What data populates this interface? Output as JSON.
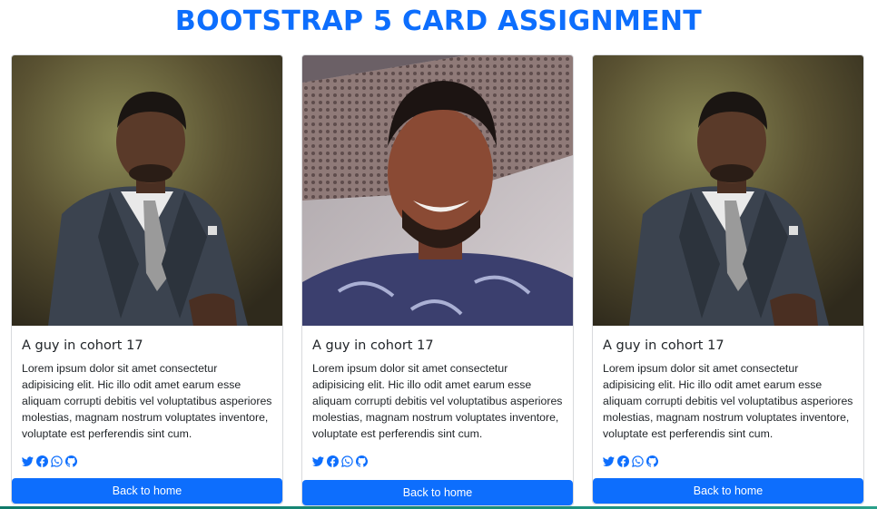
{
  "page": {
    "title": "BOOTSTRAP 5 CARD ASSIGNMENT"
  },
  "colors": {
    "accent": "#0d6efd",
    "card_border": "#d8dadd"
  },
  "cards": [
    {
      "photo": "man-in-suit-photo",
      "title": "A guy in cohort 17",
      "text": "Lorem ipsum dolor sit amet consectetur adipisicing elit. Hic illo odit amet earum esse aliquam corrupti debitis vel voluptatibus asperiores molestias, magnam nostrum voluptates inventore, voluptate est perferendis sint cum.",
      "socials": [
        "twitter-icon",
        "facebook-icon",
        "whatsapp-icon",
        "github-icon"
      ],
      "button": "Back to home"
    },
    {
      "photo": "smiling-man-selfie-photo",
      "title": "A guy in cohort 17",
      "text": "Lorem ipsum dolor sit amet consectetur adipisicing elit. Hic illo odit amet earum esse aliquam corrupti debitis vel voluptatibus asperiores molestias, magnam nostrum voluptates inventore, voluptate est perferendis sint cum.",
      "socials": [
        "twitter-icon",
        "facebook-icon",
        "whatsapp-icon",
        "github-icon"
      ],
      "button": "Back to home"
    },
    {
      "photo": "man-in-suit-photo",
      "title": "A guy in cohort 17",
      "text": "Lorem ipsum dolor sit amet consectetur adipisicing elit. Hic illo odit amet earum esse aliquam corrupti debitis vel voluptatibus asperiores molestias, magnam nostrum voluptates inventore, voluptate est perferendis sint cum.",
      "socials": [
        "twitter-icon",
        "facebook-icon",
        "whatsapp-icon",
        "github-icon"
      ],
      "button": "Back to home"
    }
  ]
}
